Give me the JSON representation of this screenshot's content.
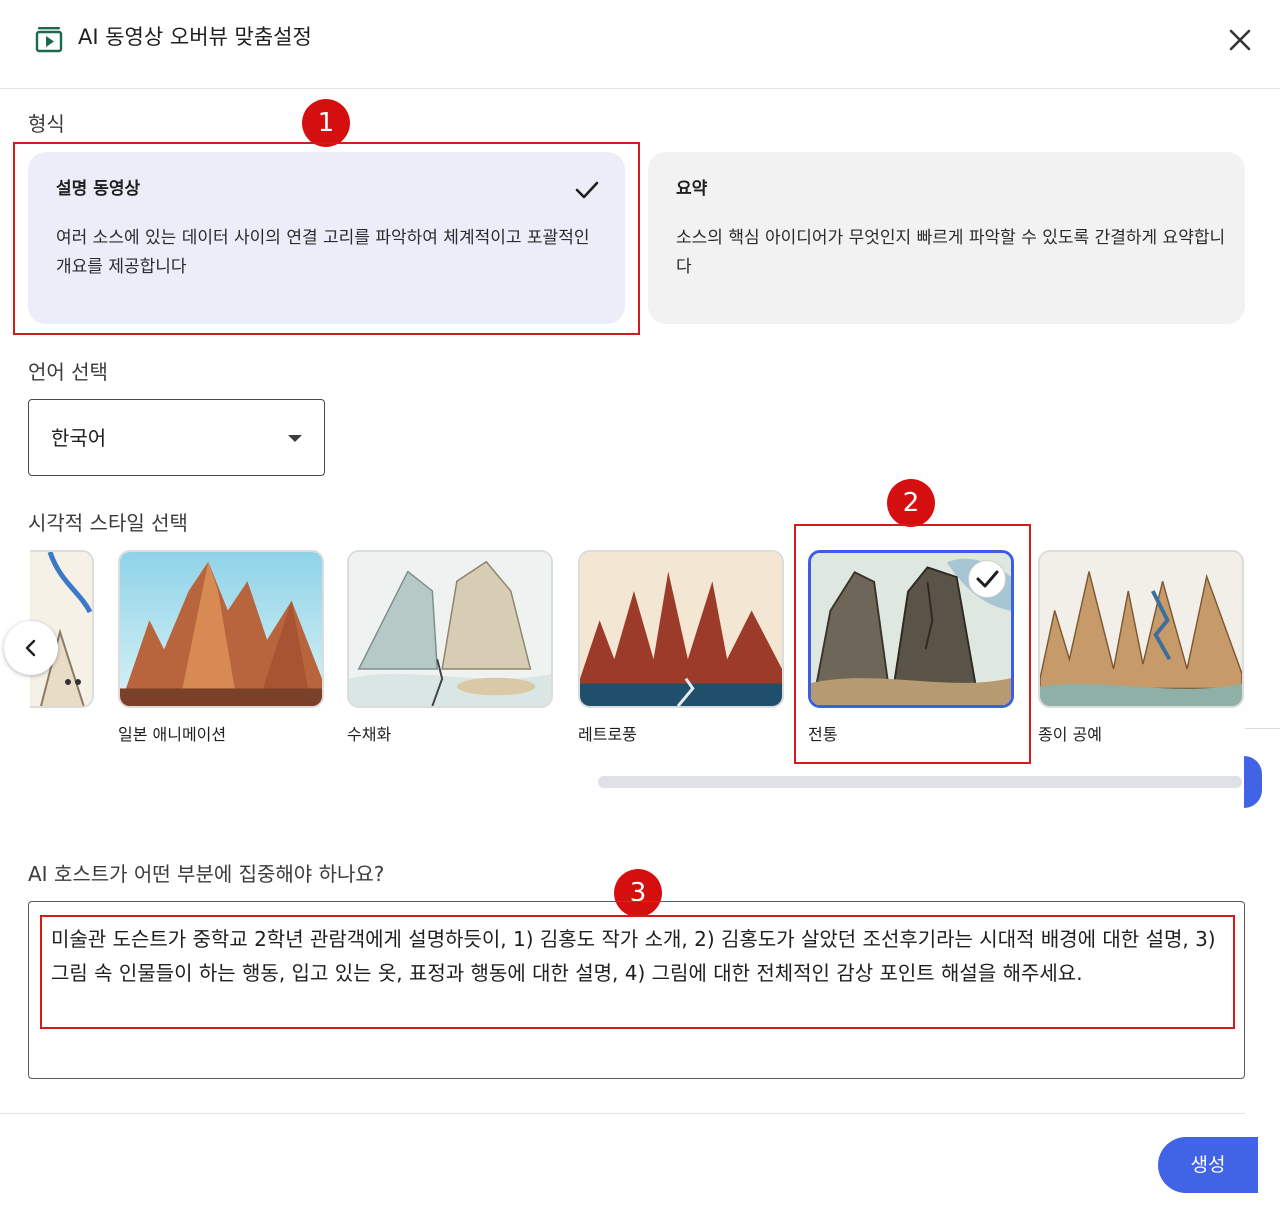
{
  "header": {
    "title": "AI 동영상 오버뷰 맞춤설정"
  },
  "format": {
    "label": "형식",
    "options": [
      {
        "title": "설명 동영상",
        "description": "여러 소스에 있는 데이터 사이의 연결 고리를 파악하여 체계적이고 포괄적인 개요를 제공합니다",
        "selected": true
      },
      {
        "title": "요약",
        "description": "소스의 핵심 아이디어가 무엇인지 빠르게 파악할 수 있도록 간결하게 요약합니다",
        "selected": false
      }
    ]
  },
  "language": {
    "label": "언어 선택",
    "selected": "한국어"
  },
  "style": {
    "label": "시각적 스타일 선택",
    "items": [
      {
        "label": "일본 애니메이션",
        "selected": false
      },
      {
        "label": "수채화",
        "selected": false
      },
      {
        "label": "레트로풍",
        "selected": false
      },
      {
        "label": "전통",
        "selected": true
      },
      {
        "label": "종이 공예",
        "selected": false
      }
    ]
  },
  "focus": {
    "label": "AI 호스트가 어떤 부분에 집중해야 하나요?",
    "value": "미술관 도슨트가 중학교 2학년 관람객에게 설명하듯이, 1) 김홍도 작가 소개, 2) 김홍도가 살았던 조선후기라는 시대적 배경에 대한 설명, 3) 그림 속 인물들이 하는 행동, 입고 있는 옷, 표정과 행동에 대한 설명, 4) 그림에 대한 전체적인 감상 포인트 해설을 해주세요."
  },
  "annotations": {
    "badge1": "1",
    "badge2": "2",
    "badge3": "3"
  },
  "actions": {
    "generate": "생성"
  },
  "colors": {
    "accent": "#4163e6",
    "annotation_red": "#d21b1b",
    "selected_card": "#ebeef8"
  }
}
